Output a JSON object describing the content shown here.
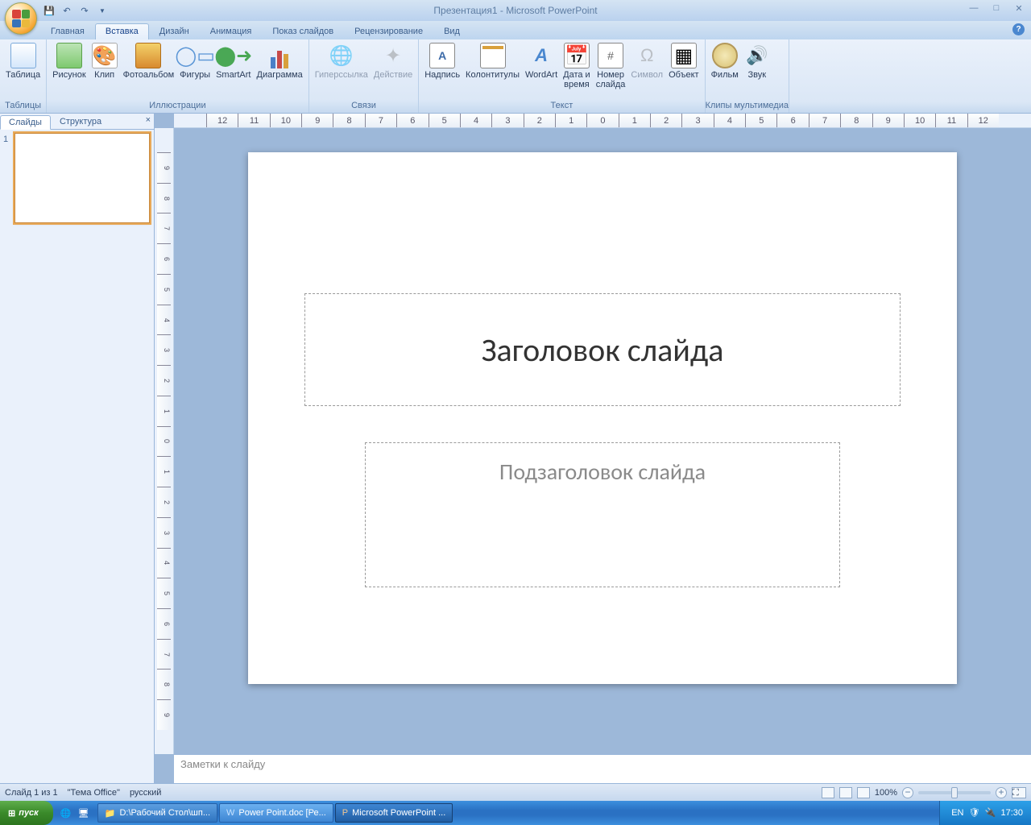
{
  "titlebar": {
    "app_title": "Презентация1 - Microsoft PowerPoint"
  },
  "tabs": {
    "home": "Главная",
    "insert": "Вставка",
    "design": "Дизайн",
    "anim": "Анимация",
    "show": "Показ слайдов",
    "review": "Рецензирование",
    "view": "Вид"
  },
  "ribbon": {
    "g_tables": "Таблицы",
    "g_illus": "Иллюстрации",
    "g_links": "Связи",
    "g_text": "Текст",
    "g_media": "Клипы мультимедиа",
    "table": "Таблица",
    "picture": "Рисунок",
    "clip": "Клип",
    "album": "Фотоальбом",
    "shapes": "Фигуры",
    "smartart": "SmartArt",
    "chart": "Диаграмма",
    "hyperlink": "Гиперссылка",
    "action": "Действие",
    "textbox": "Надпись",
    "headerfooter": "Колонтитулы",
    "wordart": "WordArt",
    "datetime": "Дата и\nвремя",
    "slidenum": "Номер\nслайда",
    "symbol": "Символ",
    "object": "Объект",
    "movie": "Фильм",
    "sound": "Звук"
  },
  "leftpane": {
    "t_slides": "Слайды",
    "t_outline": "Структура",
    "thumb_no": "1"
  },
  "slide": {
    "title": "Заголовок слайда",
    "subtitle": "Подзаголовок слайда"
  },
  "notes": {
    "placeholder": "Заметки к слайду"
  },
  "status": {
    "slide": "Слайд 1 из 1",
    "theme": "\"Тема Office\"",
    "lang": "русский",
    "zoom": "100%"
  },
  "taskbar": {
    "start": "пуск",
    "btn1": "D:\\Рабочий Стол\\шп...",
    "btn2": "Power Point.doc [Ре...",
    "btn3": "Microsoft PowerPoint ...",
    "lang": "EN",
    "clock": "17:30"
  },
  "hruler_ticks": [
    "12",
    "11",
    "10",
    "9",
    "8",
    "7",
    "6",
    "5",
    "4",
    "3",
    "2",
    "1",
    "0",
    "1",
    "2",
    "3",
    "4",
    "5",
    "6",
    "7",
    "8",
    "9",
    "10",
    "11",
    "12"
  ],
  "vruler_ticks": [
    "9",
    "8",
    "7",
    "6",
    "5",
    "4",
    "3",
    "2",
    "1",
    "0",
    "1",
    "2",
    "3",
    "4",
    "5",
    "6",
    "7",
    "8",
    "9"
  ]
}
